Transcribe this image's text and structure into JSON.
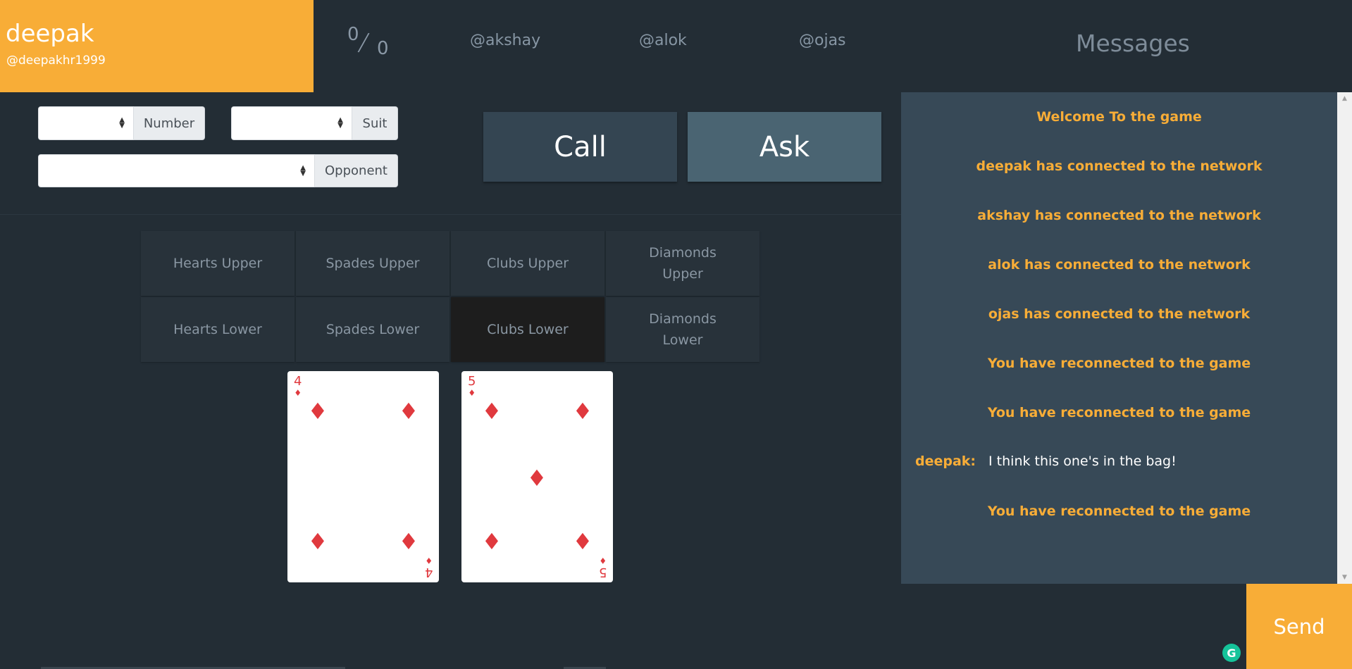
{
  "profile": {
    "name": "deepak",
    "handle": "@deepakhr1999",
    "accent_color": "#f8ad37"
  },
  "score": {
    "numerator": "0",
    "separator": "/",
    "denominator": "0"
  },
  "players": [
    "@akshay",
    "@alok",
    "@ojas"
  ],
  "messages_title": "Messages",
  "controls": {
    "number_label": "Number",
    "suit_label": "Suit",
    "opponent_label": "Opponent",
    "number_value": "",
    "suit_value": "",
    "opponent_value": ""
  },
  "actions": {
    "call": "Call",
    "ask": "Ask"
  },
  "sets": [
    {
      "line1": "Hearts Upper",
      "line2": ""
    },
    {
      "line1": "Spades Upper",
      "line2": ""
    },
    {
      "line1": "Clubs Upper",
      "line2": ""
    },
    {
      "line1": "Diamonds",
      "line2": "Upper"
    },
    {
      "line1": "Hearts Lower",
      "line2": ""
    },
    {
      "line1": "Spades Lower",
      "line2": ""
    },
    {
      "line1": "Clubs Lower",
      "line2": "",
      "selected": true
    },
    {
      "line1": "Diamonds",
      "line2": "Lower"
    }
  ],
  "hand": [
    {
      "rank": "4",
      "suit": "♦",
      "color": "#e0393e"
    },
    {
      "rank": "5",
      "suit": "♦",
      "color": "#e0393e"
    }
  ],
  "system_messages": [
    "Welcome To the game",
    "deepak has connected to the network",
    "akshay has connected to the network",
    "alok has connected to the network",
    "ojas has connected to the network",
    "You have reconnected to the game",
    "You have reconnected to the game",
    "You have reconnected to the game"
  ],
  "chat": {
    "sender": "deepak:",
    "text": "I think this one's in the bag!"
  },
  "send_label": "Send",
  "grammarly_letter": "G"
}
